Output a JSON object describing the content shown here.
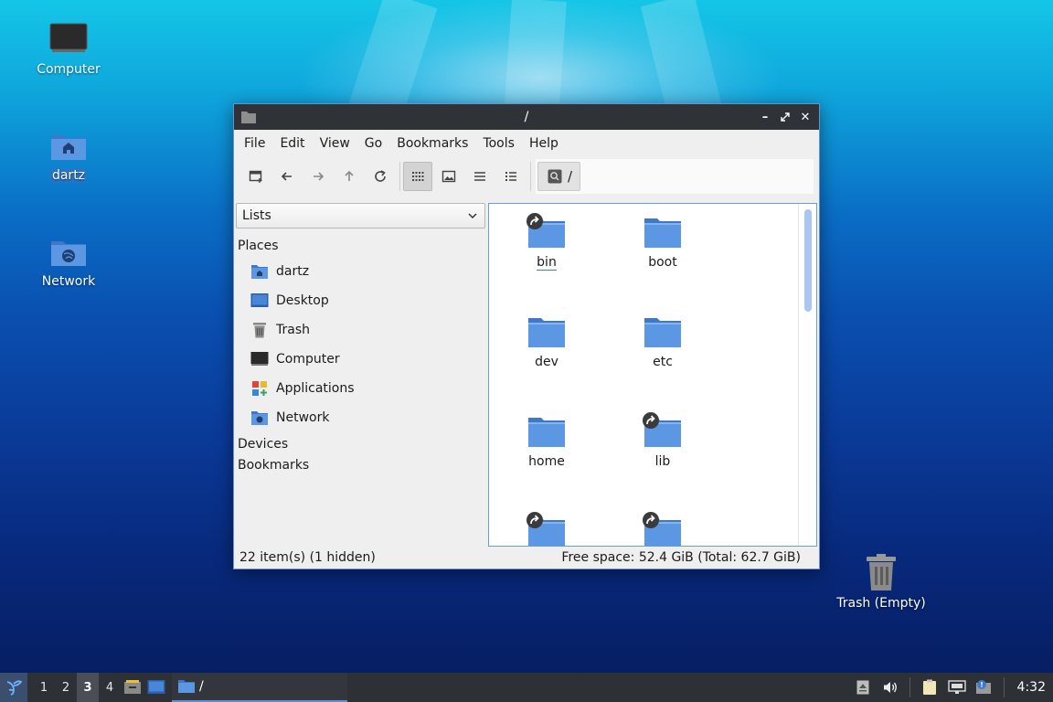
{
  "desktop": {
    "icons": [
      {
        "label": "Computer"
      },
      {
        "label": "dartz"
      },
      {
        "label": "Network"
      },
      {
        "label": "Trash (Empty)"
      }
    ]
  },
  "window": {
    "title": "/",
    "menu": [
      "File",
      "Edit",
      "View",
      "Go",
      "Bookmarks",
      "Tools",
      "Help"
    ],
    "path": "/",
    "sidebar": {
      "mode": "Lists",
      "places_header": "Places",
      "places": [
        "dartz",
        "Desktop",
        "Trash",
        "Computer",
        "Applications",
        "Network"
      ],
      "devices_header": "Devices",
      "bookmarks_header": "Bookmarks"
    },
    "files": [
      {
        "name": "bin",
        "link": true
      },
      {
        "name": "boot",
        "link": false
      },
      {
        "name": "dev",
        "link": false
      },
      {
        "name": "etc",
        "link": false
      },
      {
        "name": "home",
        "link": false
      },
      {
        "name": "lib",
        "link": true
      },
      {
        "name": "",
        "link": true
      },
      {
        "name": "",
        "link": true
      }
    ],
    "status": {
      "items": "22 item(s) (1 hidden)",
      "space": "Free space: 52.4 GiB (Total: 62.7 GiB)"
    }
  },
  "taskbar": {
    "workspaces": [
      "1",
      "2",
      "3",
      "4"
    ],
    "active_workspace": "3",
    "task_label": "/",
    "clock": "4:32"
  },
  "colors": {
    "folder": "#4a86d8",
    "titlebar": "#2f3338",
    "accent": "#3a7bd5"
  }
}
